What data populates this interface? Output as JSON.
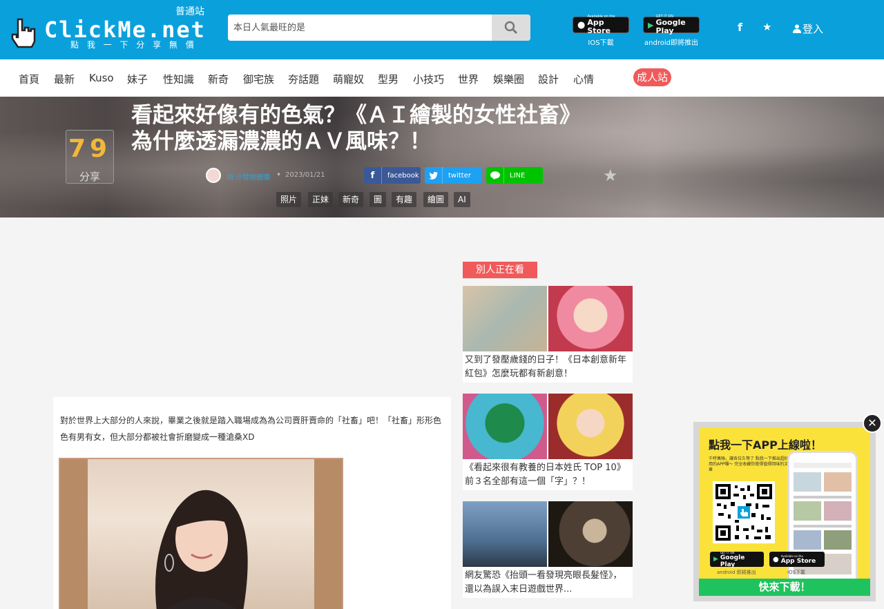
{
  "header": {
    "logo_text": "ClickMe.net",
    "slogan": "點 我 一 下  分 享 無 價",
    "site_kind": "普通站",
    "search_placeholder": "本日人氣最旺的是",
    "ios_badge_small": "Available on the",
    "ios_badge_big": "App Store",
    "ios_caption": "IOS下載",
    "android_badge_small": "GET IT ON",
    "android_badge_big": "Google Play",
    "android_caption": "android即將推出",
    "facebook_icon": "f",
    "favorite_icon": "★",
    "login_label": "登入"
  },
  "nav": {
    "items": [
      "首頁",
      "最新",
      "Kuso",
      "妹子",
      "性知識",
      "新奇",
      "御宅族",
      "夯話題",
      "萌寵奴",
      "型男",
      "小技巧",
      "世界",
      "娛樂圈",
      "設計",
      "心情"
    ],
    "adult_label": "成人站"
  },
  "hero": {
    "share_count": "79",
    "share_label": "分享",
    "title": "看起來好像有的色氣？《ＡＩ繪製的女性社畜》為什麼透漏濃濃的ＡＶ風味？！",
    "author": "由 沙發她國儀",
    "date": "2023/01/21",
    "share_facebook": "facebook",
    "share_twitter": "twitter",
    "share_line": "LINE",
    "tags": [
      "照片",
      "正妹",
      "新奇",
      "圖",
      "有趣",
      "繪圖",
      "AI"
    ]
  },
  "article": {
    "paragraph": "對於世界上大部分的人來說，畢業之後就是踏入職場成為為公司賣肝賣命的「社畜」吧！「社畜」形形色色有男有女，但大部分都被社會折磨變成一種滄桑XD"
  },
  "sidebar": {
    "heading": "別人正在看",
    "cards": [
      {
        "title": "又到了發壓歲錢的日子！《日本創意新年紅包》怎麼玩都有新創意！"
      },
      {
        "title": "《看起來很有教養的日本姓氏 TOP 10》前３名全部有這一個「字」？！"
      },
      {
        "title": "網友驚恐《抬頭一看發現亮眼長髮怪》，還以為誤入末日遊戲世界..."
      }
    ]
  },
  "popup": {
    "title": "點我一下APP上線啦！",
    "desc": "千呼萬喚，讓各位久等了 點我一下推出超好用的APP囉～ 完全收藏你覺得值得回味的文章",
    "android_small": "GET IT ON",
    "android_big": "Google Play",
    "android_caption": "android 即將推出",
    "ios_small": "Available on the",
    "ios_big": "App Store",
    "ios_caption": "IOS下載",
    "download_label": "快來下載！",
    "close_icon": "✕"
  }
}
